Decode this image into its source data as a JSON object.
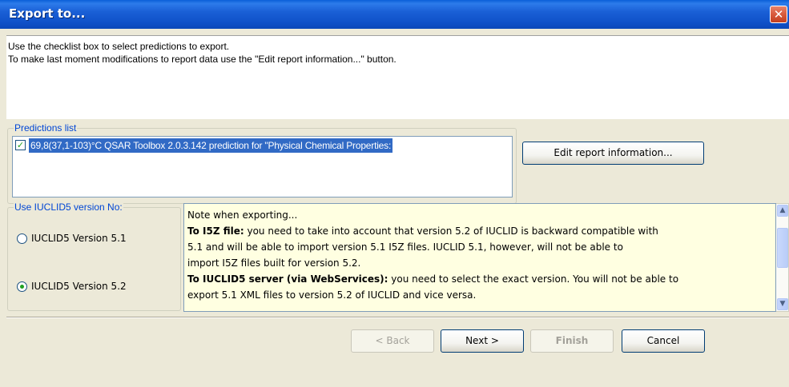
{
  "window": {
    "title": "Export to...",
    "close_symbol": "✕",
    "icons": {
      "close": "close-icon"
    }
  },
  "header": {
    "line1": "Use the checklist box to select predictions to export.",
    "line2": "To make last moment modifications to report data use the \"Edit report information...\" button."
  },
  "predictions": {
    "caption": "Predictions list",
    "items": [
      {
        "checked": true,
        "check_symbol": "✓",
        "label": "69,8(37,1-103)°C   QSAR Toolbox 2.0.3.142 prediction for \"Physical Chemical Properties:"
      }
    ],
    "edit_button": "Edit report information..."
  },
  "iuclid": {
    "caption": "Use IUCLID5 version No:",
    "options": [
      {
        "label": "IUCLID5 Version 5.1",
        "selected": false
      },
      {
        "label": "IUCLID5 Version 5.2",
        "selected": true
      }
    ]
  },
  "note": {
    "heading": "Note when exporting...",
    "i5z_title": "To I5Z file:",
    "i5z_line1": " you need to take into account that version 5.2 of IUCLID is backward compatible with",
    "i5z_line2": "5.1 and will be able to import version 5.1 I5Z files. IUCLID 5.1, however, will not be able to",
    "i5z_line3": "import I5Z  files built for version 5.2.",
    "server_title": "To IUCLID5 server (via WebServices):",
    "server_line1": " you need to select the exact version. You will not be able to",
    "server_line2": "export 5.1 XML files to version 5.2 of IUCLID and vice versa.",
    "scroll_up": "▲",
    "scroll_down": "▼"
  },
  "buttons": {
    "back": "< Back",
    "next": "Next >",
    "finish": "Finish",
    "cancel": "Cancel"
  },
  "colors": {
    "titlebar": "#0f50c8",
    "selection": "#316ac5",
    "group_caption": "#0046d5",
    "note_background": "#ffffe1",
    "check_green": "#21a121"
  }
}
